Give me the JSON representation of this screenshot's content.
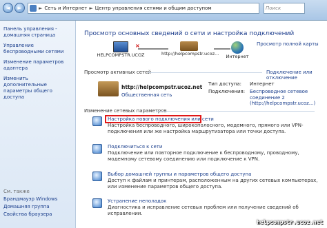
{
  "titlebar": {
    "back_glyph": "◄",
    "forward_glyph": "►",
    "breadcrumb": [
      "Сеть и Интернет",
      "Центр управления сетями и общим доступом"
    ],
    "separator": "►",
    "search_placeholder": "Поиск"
  },
  "sidebar": {
    "items": [
      {
        "label": "Панель управления - домашняя страница"
      },
      {
        "label": "Управление беспроводными сетями"
      },
      {
        "label": "Изменение параметров адаптера"
      },
      {
        "label": "Изменить дополнительные параметры общего доступа"
      }
    ],
    "see_also": "См. также",
    "bottom_items": [
      {
        "label": "Брандмауэр Windows"
      },
      {
        "label": "Домашняя группа"
      },
      {
        "label": "Свойства браузера"
      }
    ]
  },
  "main": {
    "title": "Просмотр основных сведений о сети и настройка подключений",
    "full_map_link": "Просмотр полной карты",
    "map": {
      "computer": "HELPCOMPSTR.UCOZ",
      "network": "http://helpcompstr.ucoz...",
      "internet": "Интернет"
    },
    "active_networks_title": "Просмотр активных сетей",
    "connect_disconnect_link": "Подключение или отключение",
    "active_network": {
      "name": "http://helpcompstr.ucoz.net",
      "type": "Общественная сеть",
      "access_type_label": "Тип доступа:",
      "access_type_value": "Интернет",
      "connections_label": "Подключения:",
      "connection_value": "Беспроводное сетевое соединение 2 (http://helpcompstr.ucoz...)"
    },
    "change_settings_title": "Изменение сетевых параметров",
    "tasks": [
      {
        "link": "Настройка нового подключения или сети",
        "desc": "Настройка беспроводного, широкополосного, модемного, прямого или VPN-подключения или же настройка маршрутизатора или точки доступа."
      },
      {
        "link": "Подключиться к сети",
        "desc": "Подключение или повторное подключение к беспроводному, проводному, модемному сетевому соединению или подключение к VPN."
      },
      {
        "link": "Выбор домашней группы и параметров общего доступа",
        "desc": "Доступ к файлам и принтерам, расположенным на других сетевых компьютерах, или изменение параметров общего доступа."
      },
      {
        "link": "Устранение неполадок",
        "desc": "Диагностика и исправление сетевых проблем или получение сведений об исправлении."
      }
    ]
  },
  "watermark": "helpcompstr.ucoz.net",
  "colors": {
    "link": "#1a3e8c",
    "highlight": "#e01818",
    "title": "#1a3b8b"
  }
}
